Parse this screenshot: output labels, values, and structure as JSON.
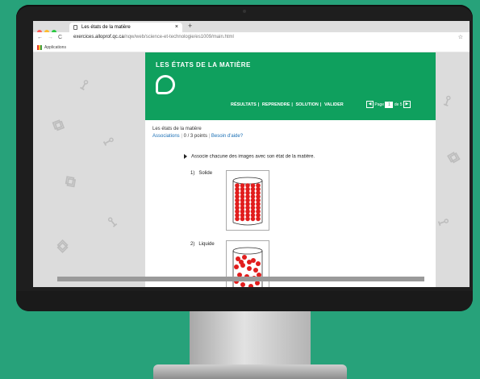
{
  "browser": {
    "tab_title": "Les états de la matière",
    "tab_close": "×",
    "new_tab": "+",
    "back": "←",
    "forward": "→",
    "reload": "C",
    "url_domain": "exercices.alloprof.qc.ca",
    "url_path": "/nqw/web/science-et-technologie/es1009/main.html",
    "star": "☆",
    "bookmark_apps": "Applications"
  },
  "header": {
    "title": "LES ÉTATS DE LA MATIÈRE",
    "menu": [
      "RÉSULTATS",
      "REPRENDRE",
      "SOLUTION",
      "VALIDER"
    ],
    "menu_sep": "|",
    "pager_label": "Page",
    "page_current": "1",
    "pager_of": "de 5",
    "prev": "◀",
    "next": "▶"
  },
  "exercise": {
    "name": "Les états de la matière",
    "type": "Associations",
    "score": "0 / 3 points",
    "help": "Besoin d'aide?",
    "instruction": "Associe chacune des images avec son état de la matière.",
    "items": [
      {
        "num": "1)",
        "label": "Solide"
      },
      {
        "num": "2)",
        "label": "Liquide"
      }
    ]
  },
  "colors": {
    "brand_green": "#0fa05e",
    "background": "#27a27a",
    "particle_red": "#e11d1d"
  }
}
